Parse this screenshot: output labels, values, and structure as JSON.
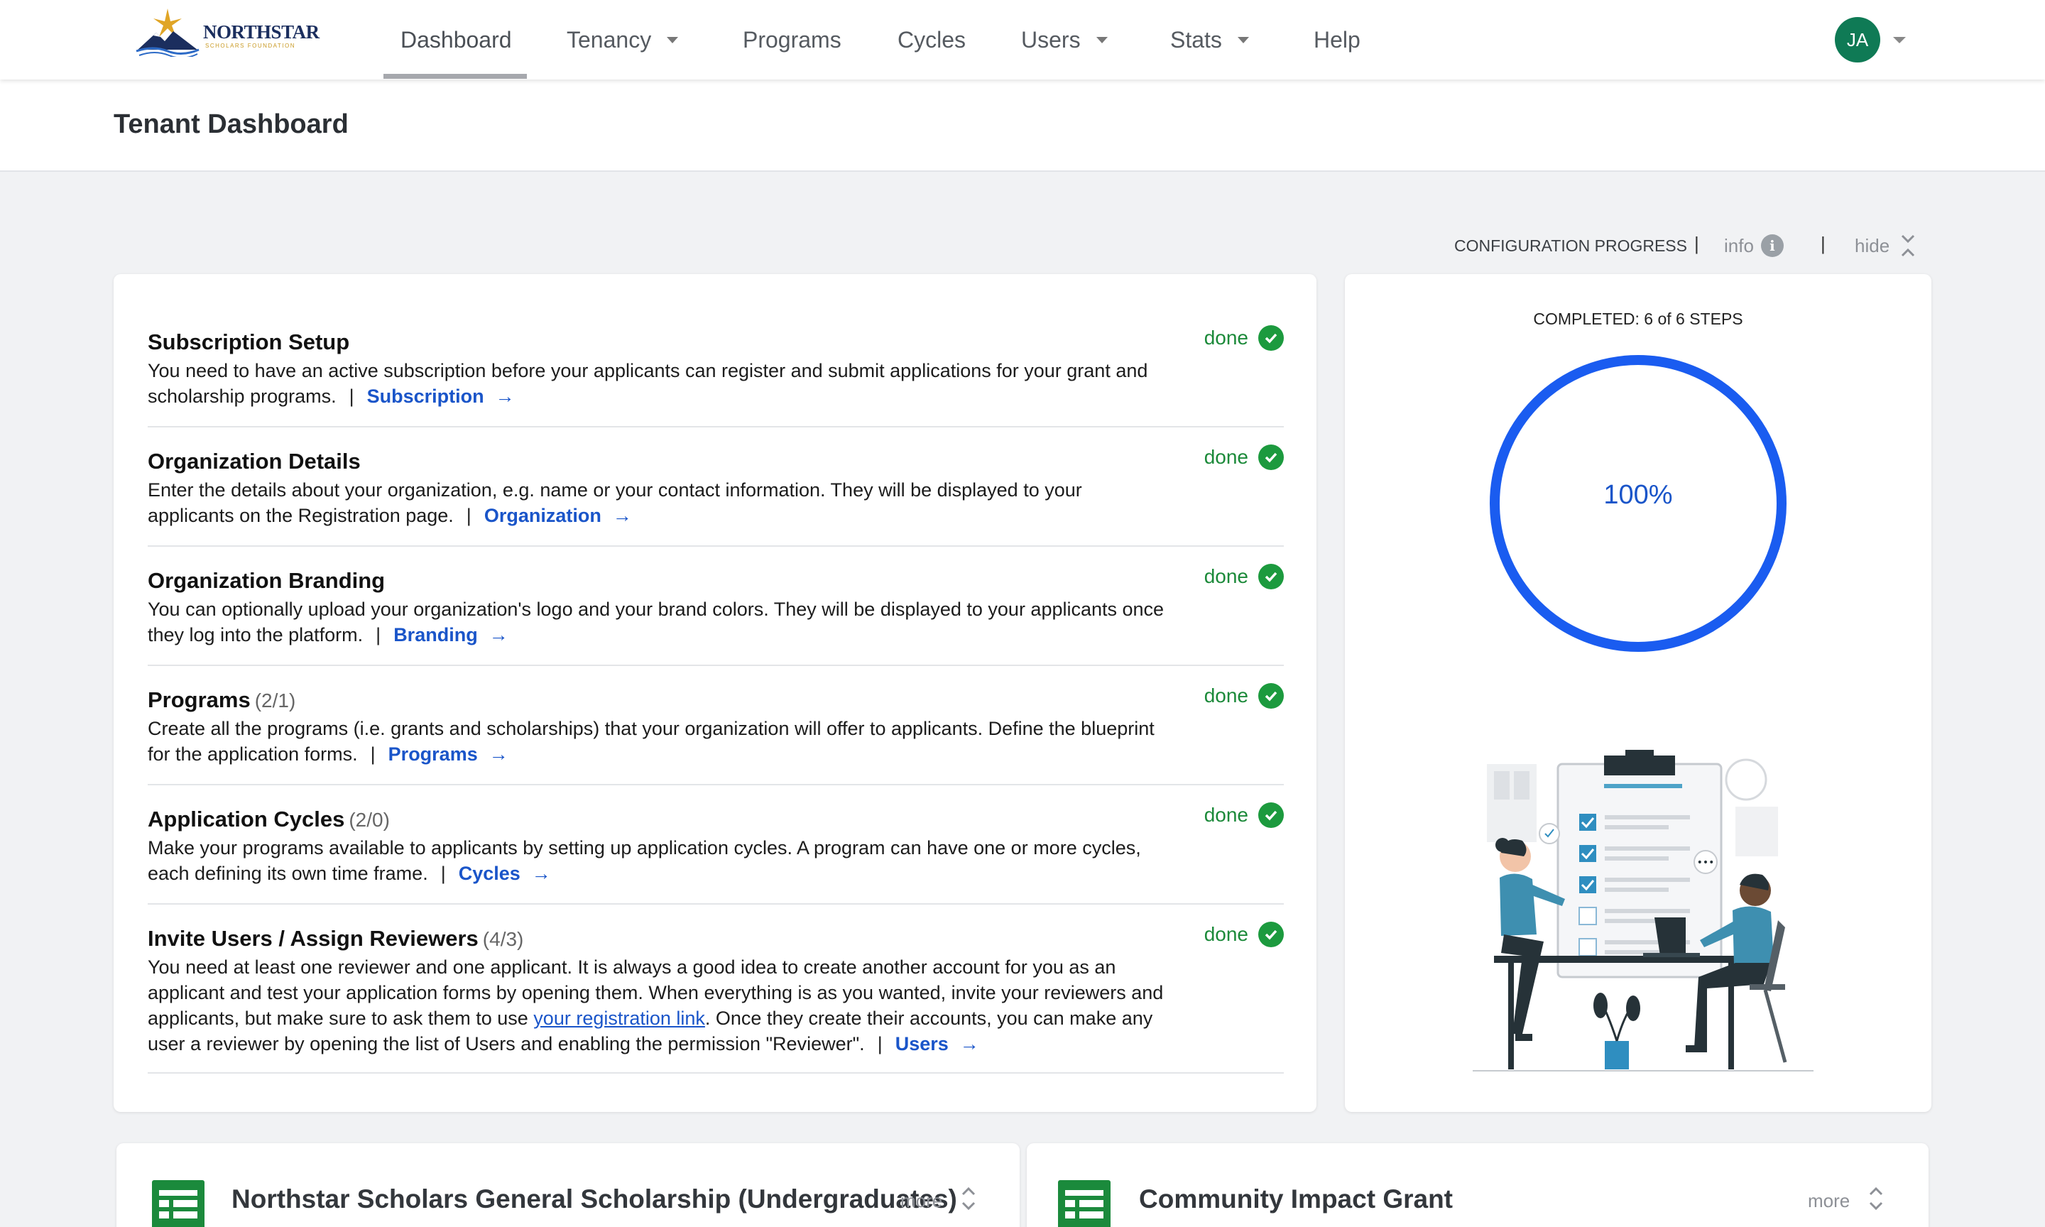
{
  "app": {
    "logo_text": "NORTHSTAR",
    "logo_subtext": "SCHOLARS FOUNDATION"
  },
  "nav": {
    "items": [
      {
        "label": "Dashboard",
        "dropdown": false,
        "active": true
      },
      {
        "label": "Tenancy",
        "dropdown": true
      },
      {
        "label": "Programs",
        "dropdown": false
      },
      {
        "label": "Cycles",
        "dropdown": false
      },
      {
        "label": "Users",
        "dropdown": true
      },
      {
        "label": "Stats",
        "dropdown": true
      },
      {
        "label": "Help",
        "dropdown": false
      }
    ],
    "avatar_initials": "JA"
  },
  "page": {
    "title": "Tenant Dashboard"
  },
  "config": {
    "heading": "CONFIGURATION PROGRESS",
    "info_label": "info",
    "hide_label": "hide",
    "separator": "|"
  },
  "steps": [
    {
      "title": "Subscription Setup",
      "count": "",
      "description": "You need to have an active subscription before your applicants can register and submit applications for your grant and scholarship programs.",
      "link_label": "Subscription",
      "status": "done"
    },
    {
      "title": "Organization Details",
      "count": "",
      "description": "Enter the details about your organization, e.g. name or your contact information. They will be displayed to your applicants on the Registration page.",
      "link_label": "Organization",
      "status": "done"
    },
    {
      "title": "Organization Branding",
      "count": "",
      "description": "You can optionally upload your organization's logo and your brand colors. They will be displayed to your applicants once they log into the platform.",
      "link_label": "Branding",
      "status": "done"
    },
    {
      "title": "Programs",
      "count": "(2/1)",
      "description": "Create all the programs (i.e. grants and scholarships) that your organization will offer to applicants. Define the blueprint for the application forms.",
      "link_label": "Programs",
      "status": "done"
    },
    {
      "title": "Application Cycles",
      "count": "(2/0)",
      "description": "Make your programs available to applicants by setting up application cycles. A program can have one or more cycles, each defining its own time frame.",
      "link_label": "Cycles",
      "status": "done"
    },
    {
      "title": "Invite Users / Assign Reviewers",
      "count": "(4/3)",
      "description_pre": "You need at least one reviewer and one applicant. It is always a good idea to create another account for you as an applicant and test your application forms by opening them. When everything is as you wanted, invite your reviewers and applicants, but make sure to ask them to use ",
      "description_link": "your registration link",
      "description_post": ". Once they create their accounts, you can make any user a reviewer by opening the list of Users and enabling the permission \"Reviewer\".",
      "link_label": "Users",
      "status": "done"
    }
  ],
  "progress": {
    "completed_label": "COMPLETED: 6 of 6 STEPS",
    "percent_label": "100%",
    "percent": 100,
    "ring_color": "#1a5cf0"
  },
  "programs": [
    {
      "title": "Northstar Scholars General Scholarship (Undergraduates)",
      "more_label": "more"
    },
    {
      "title": "Community Impact Grant",
      "more_label": "more"
    }
  ],
  "icons": {
    "check": "check-circle-icon",
    "arrow": "arrow-right-icon",
    "info": "info-circle-icon",
    "hide": "collapse-chevrons-icon",
    "program": "spreadsheet-icon"
  },
  "colors": {
    "link": "#1a55c9",
    "done": "#1c8a3a",
    "avatar": "#0f7a55",
    "program_icon": "#1b8a3c"
  }
}
